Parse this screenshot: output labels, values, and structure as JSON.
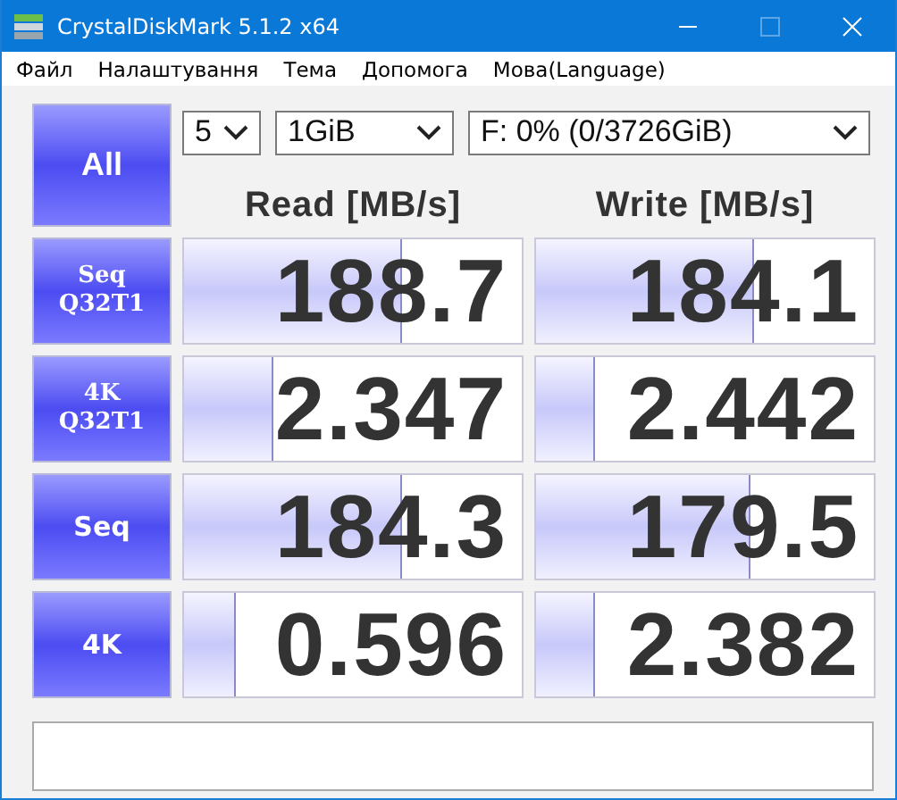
{
  "window": {
    "title": "CrystalDiskMark 5.1.2 x64"
  },
  "menu": [
    "Файл",
    "Налаштування",
    "Тема",
    "Допомога",
    "Мова(Language)"
  ],
  "all_button": {
    "label": "All"
  },
  "selects": [
    {
      "value": "5"
    },
    {
      "value": "1GiB"
    },
    {
      "value": "F: 0% (0/3726GiB)"
    }
  ],
  "headers": [
    "Read [MB/s]",
    "Write [MB/s]"
  ],
  "tests": [
    {
      "label": [
        "Seq",
        "Q32T1"
      ],
      "read": {
        "value": "188.7",
        "level": 0.64
      },
      "write": {
        "value": "184.1",
        "level": 0.64
      }
    },
    {
      "label": [
        "4K",
        "Q32T1"
      ],
      "read": {
        "value": "2.347",
        "level": 0.26
      },
      "write": {
        "value": "2.442",
        "level": 0.17
      }
    },
    {
      "label": [
        "Seq"
      ],
      "read": {
        "value": "184.3",
        "level": 0.64
      },
      "write": {
        "value": "179.5",
        "level": 0.63
      }
    },
    {
      "label": [
        "4K"
      ],
      "read": {
        "value": "0.596",
        "level": 0.15
      },
      "write": {
        "value": "2.382",
        "level": 0.17
      }
    }
  ]
}
